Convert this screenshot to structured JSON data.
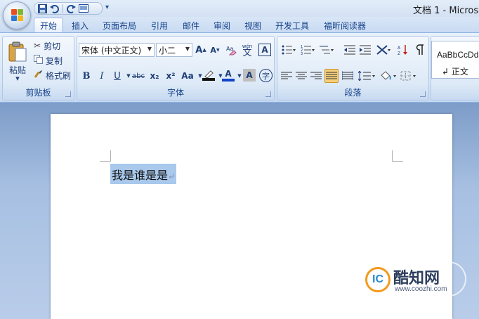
{
  "window": {
    "title": "文档 1 - Microso"
  },
  "qat": {
    "icons": [
      "save-icon",
      "undo-icon",
      "redo-icon",
      "print-preview-icon"
    ],
    "more": "₹"
  },
  "tabs": [
    "开始",
    "插入",
    "页面布局",
    "引用",
    "邮件",
    "审阅",
    "视图",
    "开发工具",
    "福昕阅读器"
  ],
  "clipboard": {
    "label": "剪贴板",
    "paste": "粘贴",
    "cut": "剪切",
    "copy": "复制",
    "format_painter": "格式刷"
  },
  "font": {
    "label": "字体",
    "font_name": "宋体 (中文正文)",
    "font_size": "小二",
    "grow": "A",
    "shrink": "A",
    "phonetic": "wén",
    "char_border": "A",
    "bold": "B",
    "italic": "I",
    "underline": "U",
    "strike": "abc",
    "subscript": "x₂",
    "superscript": "x²",
    "case": "Aa",
    "highlight": "ab",
    "font_color": "A",
    "char_shade": "A",
    "enclose": "字"
  },
  "paragraph": {
    "label": "段落"
  },
  "styles": {
    "name": "AaBbCcDd",
    "sub": "↲ 正文"
  },
  "document": {
    "text": "我是谁是是",
    "para_mark": "↵"
  },
  "watermark": {
    "logo_text": "IC",
    "title": "酷知网",
    "url": "www.coozhi.com"
  },
  "colors": {
    "accent": "#15428b",
    "highlight": "#a8c8ec",
    "ribbon": "#dfe9f6"
  }
}
